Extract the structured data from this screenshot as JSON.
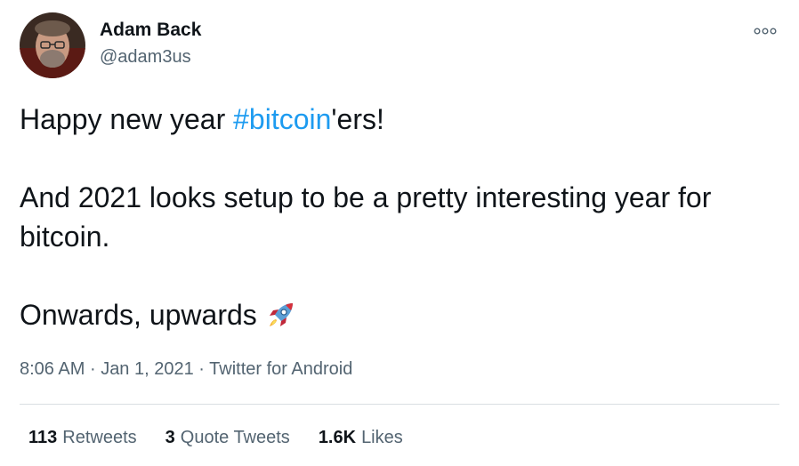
{
  "author": {
    "name": "Adam Back",
    "handle": "@adam3us"
  },
  "tweet": {
    "line1_before": "Happy new year ",
    "hashtag": "#bitcoin",
    "line1_after": "'ers!",
    "line2": "And 2021 looks setup to be a pretty interesting year for bitcoin.",
    "line3": "Onwards, upwards",
    "emoji_icon": "rocket-emoji"
  },
  "meta": {
    "time": "8:06 AM",
    "separator": "·",
    "date": "Jan 1, 2021",
    "source": "Twitter for Android"
  },
  "stats": {
    "retweets_count": "113",
    "retweets_label": "Retweets",
    "quotes_count": "3",
    "quotes_label": "Quote Tweets",
    "likes_count": "1.6K",
    "likes_label": "Likes"
  },
  "colors": {
    "link": "#1d9bf0",
    "secondary_text": "#536471",
    "primary_text": "#0f1419"
  }
}
